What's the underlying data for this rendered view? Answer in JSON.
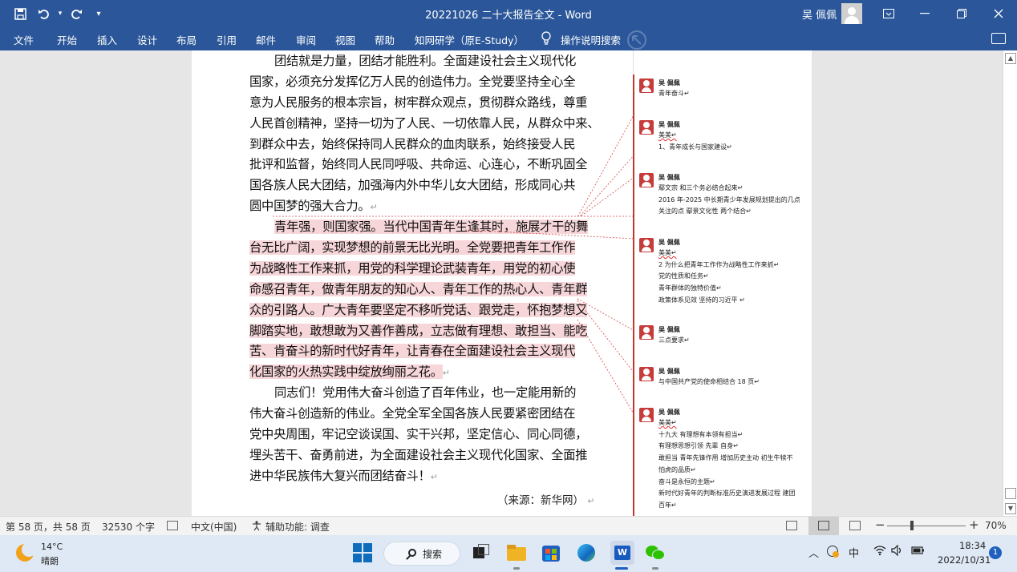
{
  "titlebar": {
    "title": "20221026  二十大报告全文  -  Word",
    "user": "吴 佩佩",
    "save_icon": "save-icon",
    "undo_icon": "undo-icon",
    "redo_icon": "redo-icon"
  },
  "ribbon": {
    "tabs": [
      "文件",
      "开始",
      "插入",
      "设计",
      "布局",
      "引用",
      "邮件",
      "审阅",
      "视图",
      "帮助",
      "知网研学（原E-Study）"
    ],
    "tell_me": "操作说明搜索"
  },
  "document": {
    "body_lines": [
      {
        "text": "团结就是力量，团结才能胜利。全面建设社会主义现代化",
        "indent": true,
        "hl": false,
        "mark": false
      },
      {
        "text": "国家，必须充分发挥亿万人民的创造伟力。全党要坚持全心全",
        "indent": false,
        "hl": false,
        "mark": false
      },
      {
        "text": "意为人民服务的根本宗旨，树牢群众观点，贯彻群众路线，尊重",
        "indent": false,
        "hl": false,
        "mark": false
      },
      {
        "text": "人民首创精神，坚持一切为了人民、一切依靠人民，从群众中来、",
        "indent": false,
        "hl": false,
        "mark": false
      },
      {
        "text": "到群众中去，始终保持同人民群众的血肉联系，始终接受人民",
        "indent": false,
        "hl": false,
        "mark": false
      },
      {
        "text": "批评和监督，始终同人民同呼吸、共命运、心连心，不断巩固全",
        "indent": false,
        "hl": false,
        "mark": false
      },
      {
        "text": "国各族人民大团结，加强海内外中华儿女大团结，形成同心共",
        "indent": false,
        "hl": false,
        "mark": false
      },
      {
        "text": "圆中国梦的强大合力。",
        "indent": false,
        "hl": false,
        "mark": true
      },
      {
        "text": "青年强，则国家强。当代中国青年生逢其时，施展才干的舞",
        "indent": true,
        "hl": true,
        "mark": false
      },
      {
        "text": "台无比广阔，实现梦想的前景无比光明。全党要把青年工作作",
        "indent": false,
        "hl": true,
        "mark": false
      },
      {
        "text": "为战略性工作来抓，用党的科学理论武装青年，用党的初心使",
        "indent": false,
        "hl": true,
        "mark": false
      },
      {
        "text": "命感召青年，做青年朋友的知心人、青年工作的热心人、青年群",
        "indent": false,
        "hl": true,
        "mark": false
      },
      {
        "text": "众的引路人。广大青年要坚定不移听党话、跟党走，怀抱梦想又",
        "indent": false,
        "hl": true,
        "mark": false
      },
      {
        "text": "脚踏实地，敢想敢为又善作善成，立志做有理想、敢担当、能吃",
        "indent": false,
        "hl": true,
        "mark": false
      },
      {
        "text": "苦、肯奋斗的新时代好青年，让青春在全面建设社会主义现代",
        "indent": false,
        "hl": true,
        "mark": false
      },
      {
        "text": "化国家的火热实践中绽放绚丽之花。",
        "indent": false,
        "hl": true,
        "mark": true
      },
      {
        "text": "同志们！党用伟大奋斗创造了百年伟业，也一定能用新的",
        "indent": true,
        "hl": false,
        "mark": false
      },
      {
        "text": "伟大奋斗创造新的伟业。全党全军全国各族人民要紧密团结在",
        "indent": false,
        "hl": false,
        "mark": false
      },
      {
        "text": "党中央周围，牢记空谈误国、实干兴邦，坚定信心、同心同德，",
        "indent": false,
        "hl": false,
        "mark": false
      },
      {
        "text": "埋头苦干、奋勇前进，为全面建设社会主义现代化国家、全面推",
        "indent": false,
        "hl": false,
        "mark": false
      },
      {
        "text": "进中华民族伟大复兴而团结奋斗！",
        "indent": false,
        "hl": false,
        "mark": true
      }
    ],
    "source": "（来源：新华网）",
    "paragraph_mark": "↵"
  },
  "comments": [
    {
      "author": "吴 佩佩",
      "lines": [
        "青年奋斗↵"
      ]
    },
    {
      "author": "吴 佩佩",
      "lines": [
        "美美↵",
        "1、青年成长与国家建设↵"
      ]
    },
    {
      "author": "吴 佩佩",
      "lines": [
        "鄢文宗  和三个务必结合起来↵",
        "2016 年-2025 中长期青少年发展规划提出的几点",
        "关注的点  鄢景文化性  两个结合↵"
      ]
    },
    {
      "author": "吴 佩佩",
      "lines": [
        "美美↵",
        "2 为什么把青年工作作为战略性工作来抓↵",
        "党的性质和任务↵",
        "青年群体的独特价值↵",
        "政策体系见效  坚持的习近平 ↵"
      ]
    },
    {
      "author": "吴 佩佩",
      "lines": [
        "三点要求↵"
      ]
    },
    {
      "author": "吴 佩佩",
      "lines": [
        "与中国共产党的使命相结合 18 页↵"
      ]
    },
    {
      "author": "吴 佩佩",
      "lines": [
        "美美↵",
        "十九大  有理想有本领有担当↵",
        "有理想思想引领  先辈  自身↵",
        "敢担当  青年先锋作用  增加历史主动  初生牛犊不",
        "怕虎的品质↵",
        "奋斗是永恒的主题↵",
        "新时代好青年的判断标准历史演进发展过程  建团",
        "百年↵"
      ]
    }
  ],
  "statusbar": {
    "page": "第 58 页，共 58 页",
    "words": "32530 个字",
    "language": "中文(中国)",
    "accessibility": "辅助功能: 调查",
    "zoom": "70%",
    "zoom_percent": 70
  },
  "taskbar": {
    "temp": "14°C",
    "condition": "晴朗",
    "search": "搜索",
    "ime": "中",
    "time": "18:34",
    "date": "2022/10/31",
    "notifications": "1"
  },
  "colors": {
    "title_bar": "#2b579a",
    "highlight": "#f7d6d9",
    "comment_accent": "#c63b3b"
  }
}
